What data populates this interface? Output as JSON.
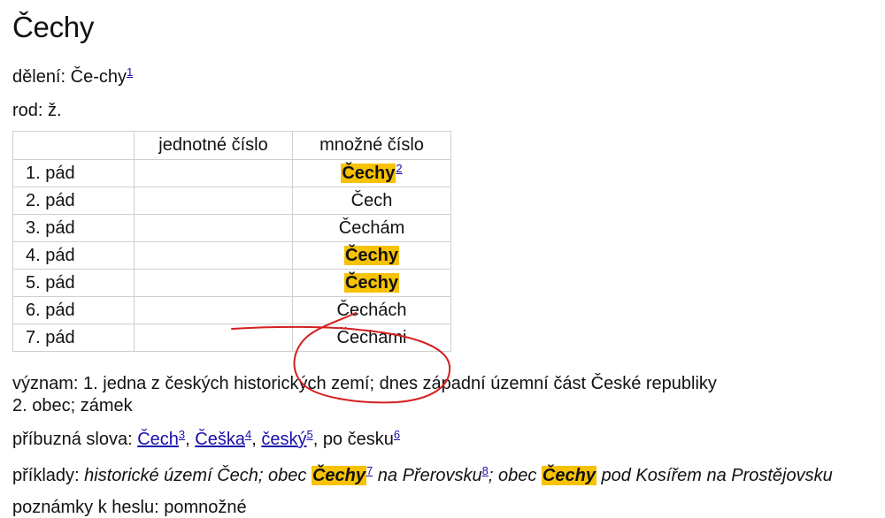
{
  "title": "Čechy",
  "deleni": {
    "label": "dělení:",
    "value": "Če-chy",
    "ref": "1"
  },
  "rod": {
    "label": "rod:",
    "value": "ž."
  },
  "table": {
    "headers": [
      "",
      "jednotné číslo",
      "množné číslo"
    ],
    "rows": [
      {
        "case": "1. pád",
        "sg": "",
        "pl": "Čechy",
        "ref": "2",
        "highlight": true
      },
      {
        "case": "2. pád",
        "sg": "",
        "pl": "Čech",
        "ref": "",
        "highlight": false
      },
      {
        "case": "3. pád",
        "sg": "",
        "pl": "Čechám",
        "ref": "",
        "highlight": false
      },
      {
        "case": "4. pád",
        "sg": "",
        "pl": "Čechy",
        "ref": "",
        "highlight": true
      },
      {
        "case": "5. pád",
        "sg": "",
        "pl": "Čechy",
        "ref": "",
        "highlight": true
      },
      {
        "case": "6. pád",
        "sg": "",
        "pl": "Čechách",
        "ref": "",
        "highlight": false
      },
      {
        "case": "7. pád",
        "sg": "",
        "pl": "Čechami",
        "ref": "",
        "highlight": false
      }
    ]
  },
  "vyznam": {
    "label": "význam:",
    "line1": "1. jedna z českých historických zemí; dnes západní územní část České republiky",
    "line2": "2. obec; zámek"
  },
  "pribuzna": {
    "label": "příbuzná slova:",
    "words": [
      {
        "text": "Čech",
        "ref": "3"
      },
      {
        "text": "Češka",
        "ref": "4"
      },
      {
        "text": "český",
        "ref": "5"
      }
    ],
    "last": "po česku",
    "last_ref": "6"
  },
  "priklady": {
    "label": "příklady:",
    "p1": "historické území Čech; obec",
    "hl1": "Čechy",
    "ref1": "7",
    "p2": "na Přerovsku",
    "ref2": "8",
    "p3": "; obec",
    "hl2": "Čechy",
    "p4": "pod Kosířem na Prostějovsku"
  },
  "poznamky": {
    "label": "poznámky k heslu:",
    "value": "pomnožné"
  },
  "colors": {
    "highlight": "#f7c204",
    "link": "#1a0dab",
    "annotation": "#d42020"
  }
}
